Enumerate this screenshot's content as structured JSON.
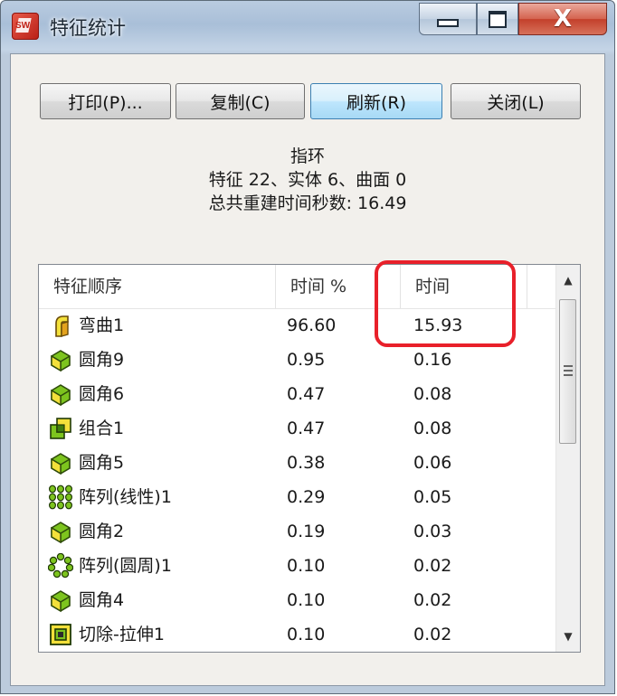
{
  "window": {
    "title": "特征统计",
    "minimize_label": "",
    "maximize_label": "",
    "close_label": "X"
  },
  "buttons": {
    "print": "打印(P)...",
    "copy": "复制(C)",
    "refresh": "刷新(R)",
    "close": "关闭(L)"
  },
  "summary": {
    "part_name": "指环",
    "counts": "特征 22、实体 6、曲面 0",
    "rebuild_time": "总共重建时间秒数: 16.49"
  },
  "table": {
    "headers": [
      "特征顺序",
      "时间 %",
      "时间"
    ],
    "rows": [
      {
        "icon": "flex-feature-icon",
        "name": "弯曲1",
        "pct": "96.60",
        "time": "15.93"
      },
      {
        "icon": "fillet-icon",
        "name": "圆角9",
        "pct": "0.95",
        "time": "0.16"
      },
      {
        "icon": "fillet-icon",
        "name": "圆角6",
        "pct": "0.47",
        "time": "0.08"
      },
      {
        "icon": "combine-icon",
        "name": "组合1",
        "pct": "0.47",
        "time": "0.08"
      },
      {
        "icon": "fillet-icon",
        "name": "圆角5",
        "pct": "0.38",
        "time": "0.06"
      },
      {
        "icon": "linear-pattern-icon",
        "name": "阵列(线性)1",
        "pct": "0.29",
        "time": "0.05"
      },
      {
        "icon": "fillet-icon",
        "name": "圆角2",
        "pct": "0.19",
        "time": "0.03"
      },
      {
        "icon": "circular-pattern-icon",
        "name": "阵列(圆周)1",
        "pct": "0.10",
        "time": "0.02"
      },
      {
        "icon": "fillet-icon",
        "name": "圆角4",
        "pct": "0.10",
        "time": "0.02"
      },
      {
        "icon": "extruded-cut-icon",
        "name": "切除-拉伸1",
        "pct": "0.10",
        "time": "0.02"
      }
    ]
  },
  "colors": {
    "highlight": "#e8202a",
    "icon_green": "#7dc41e",
    "icon_yellow": "#f3e03a"
  }
}
